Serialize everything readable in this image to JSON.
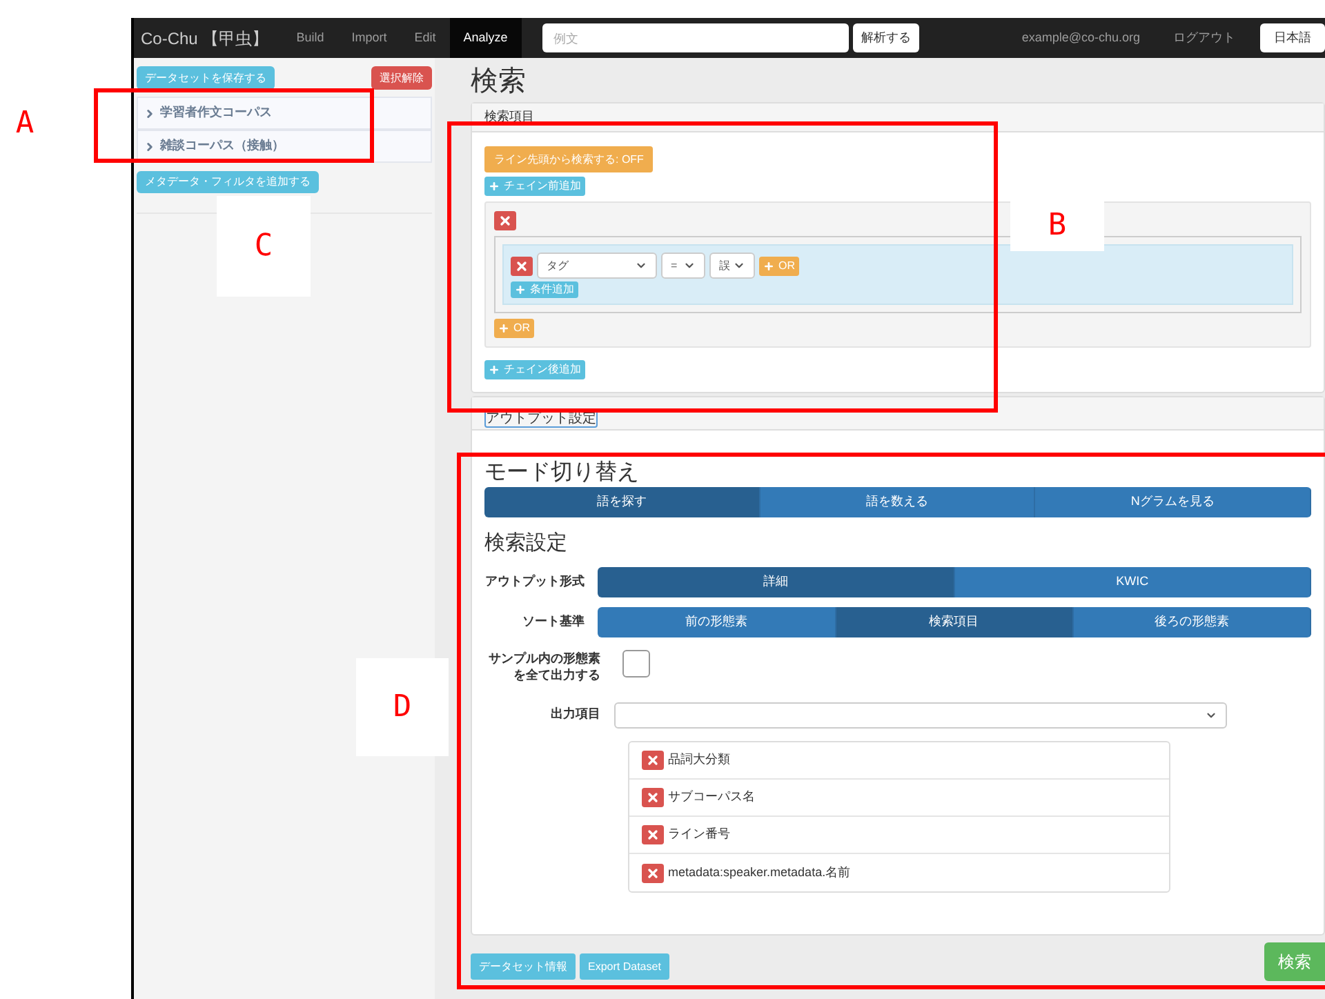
{
  "navbar": {
    "brand": "Co-Chu 【甲虫】",
    "items": [
      {
        "label": "Build",
        "selected": false
      },
      {
        "label": "Import",
        "selected": false
      },
      {
        "label": "Edit",
        "selected": false
      },
      {
        "label": "Analyze",
        "selected": true
      }
    ],
    "search": {
      "placeholder": "例文"
    },
    "parse_button": "解析する",
    "email": "example@co-chu.org",
    "logout": "ログアウト",
    "language": "日本語"
  },
  "sidebar": {
    "save_button": "データセットを保存する",
    "clear_button": "選択解除",
    "corpora": [
      {
        "label": "学習者作文コーパス"
      },
      {
        "label": "雑談コーパス（接触）"
      }
    ],
    "add_filter_button": "メタデータ・フィルタを追加する"
  },
  "main": {
    "title": "検索",
    "query_panel": {
      "header": "検索項目",
      "line_start_toggle": "ライン先頭から検索する: OFF",
      "add_before": "チェイン前追加",
      "condition": {
        "field": "タグ",
        "operator": "=",
        "value": "誤",
        "or_button": "OR",
        "add_condition": "条件追加"
      },
      "or_button": "OR",
      "add_after": "チェイン後追加"
    },
    "output_panel": {
      "header": "アウトプット設定",
      "mode_heading": "モード切り替え",
      "modes": [
        {
          "label": "語を探す",
          "selected": true
        },
        {
          "label": "語を数える",
          "selected": false
        },
        {
          "label": "Nグラムを見る",
          "selected": false
        }
      ],
      "settings_heading": "検索設定",
      "output_format": {
        "label": "アウトプット形式",
        "options": [
          {
            "label": "詳細",
            "selected": true
          },
          {
            "label": "KWIC",
            "selected": false
          }
        ]
      },
      "sort": {
        "label": "ソート基準",
        "options": [
          {
            "label": "前の形態素",
            "selected": false
          },
          {
            "label": "検索項目",
            "selected": true
          },
          {
            "label": "後ろの形態素",
            "selected": false
          }
        ]
      },
      "all_morphemes": {
        "label_lines": [
          "サンプル内の形態素",
          "を全て出力する"
        ],
        "checked": false
      },
      "output_items": {
        "label": "出力項目",
        "items": [
          "品詞大分類",
          "サブコーパス名",
          "ライン番号",
          "metadata:speaker.metadata.名前"
        ]
      }
    },
    "footer_buttons": [
      "データセット情報",
      "Export Dataset"
    ],
    "search_button": "検索"
  },
  "annotations": [
    {
      "label": "A"
    },
    {
      "label": "B"
    },
    {
      "label": "C"
    },
    {
      "label": "D"
    }
  ]
}
